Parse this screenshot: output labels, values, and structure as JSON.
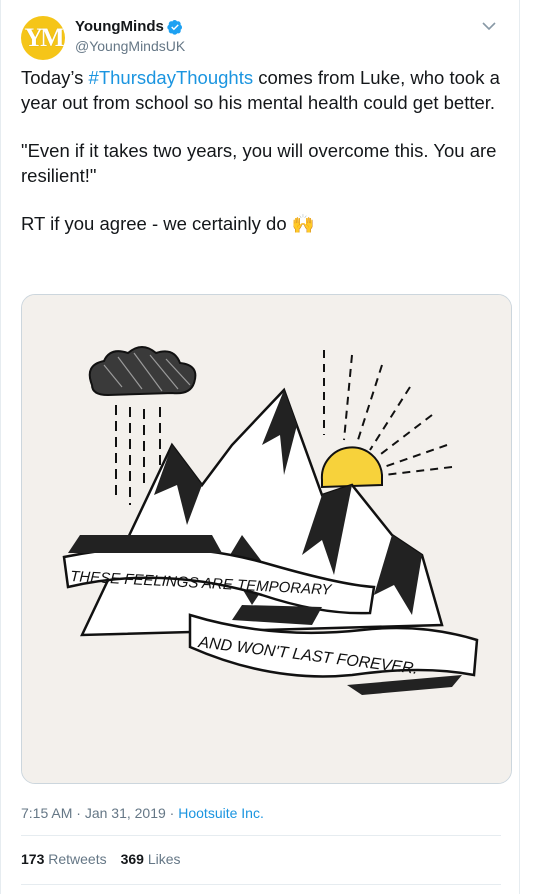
{
  "account": {
    "display_name": "YoungMinds",
    "handle": "@YoungMindsUK",
    "avatar_text": "YM",
    "verified": true
  },
  "tweet": {
    "line1_pre": "Today’s ",
    "hashtag": "#ThursdayThoughts",
    "line1_post": " comes from Luke, who took a year out from school so his mental health could get better.",
    "quote": "\"Even if it takes two years, you will overcome this. You are resilient!\"",
    "cta": "RT if you agree - we certainly do",
    "emoji": "🙌"
  },
  "illustration": {
    "banner_top": "THESE FEELINGS ARE TEMPORARY",
    "banner_bottom": "AND WON'T LAST FOREVER."
  },
  "meta": {
    "time": "7:15 AM",
    "sep": " · ",
    "date": "Jan 31, 2019",
    "source": "Hootsuite Inc."
  },
  "stats": {
    "retweets_count": "173",
    "retweets_label": "Retweets",
    "likes_count": "369",
    "likes_label": "Likes"
  },
  "colors": {
    "link": "#1b95e0",
    "text": "#14171a",
    "muted": "#657786",
    "avatar": "#f5c518",
    "sun": "#f7d23b"
  }
}
